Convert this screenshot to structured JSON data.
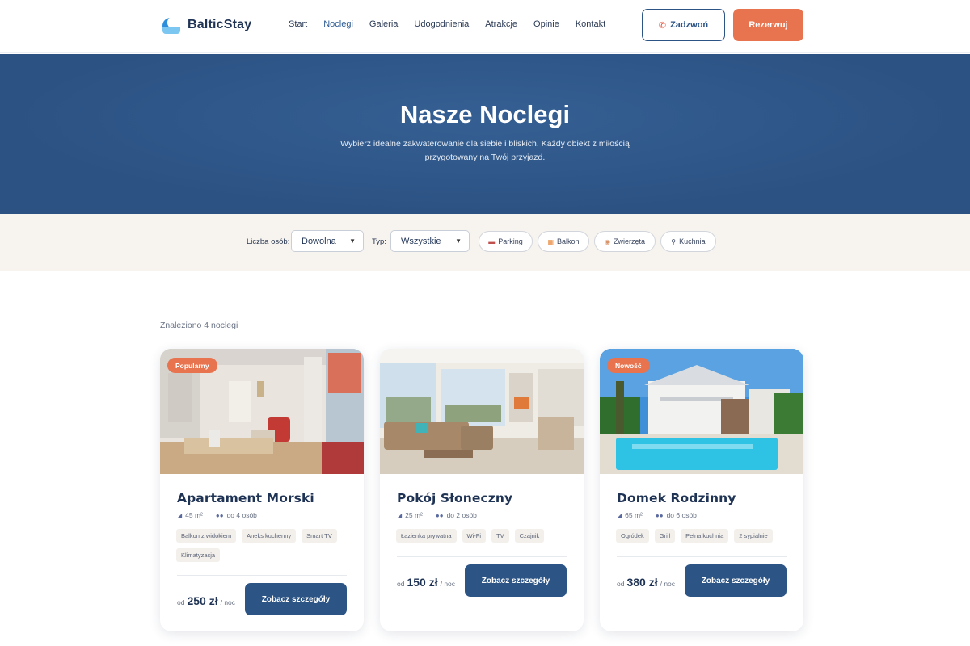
{
  "brand": {
    "name": "BalticStay"
  },
  "nav": {
    "items": [
      {
        "label": "Start",
        "active": false
      },
      {
        "label": "Noclegi",
        "active": true
      },
      {
        "label": "Galeria",
        "active": false
      },
      {
        "label": "Udogodnienia",
        "active": false
      },
      {
        "label": "Atrakcje",
        "active": false
      },
      {
        "label": "Opinie",
        "active": false
      },
      {
        "label": "Kontakt",
        "active": false
      }
    ],
    "call_label": "Zadzwoń",
    "book_label": "Rezerwuj"
  },
  "hero": {
    "title": "Nasze Noclegi",
    "subtitle": "Wybierz idealne zakwaterowanie dla siebie i bliskich. Każdy obiekt z miłością przygotowany na Twój przyjazd."
  },
  "filters": {
    "guests_label": "Liczba osób:",
    "guests_value": "Dowolna",
    "type_label": "Typ:",
    "type_value": "Wszystkie",
    "chips": [
      {
        "label": "Parking",
        "icon": "car-icon"
      },
      {
        "label": "Balkon",
        "icon": "balcony-icon"
      },
      {
        "label": "Zwierzęta",
        "icon": "pet-icon"
      },
      {
        "label": "Kuchnia",
        "icon": "kitchen-icon"
      }
    ]
  },
  "results": {
    "count_text": "Znaleziono 4 noclegi"
  },
  "cards": [
    {
      "badge": "Popularny",
      "title": "Apartament Morski",
      "area": "45 m²",
      "guests": "do 4 osób",
      "tags": [
        "Balkon z widokiem",
        "Aneks kuchenny",
        "Smart TV",
        "Klimatyzacja"
      ],
      "price_prefix": "od",
      "price": "250 zł",
      "price_suffix": "/ noc",
      "button": "Zobacz szczegóły"
    },
    {
      "badge": "",
      "title": "Pokój Słoneczny",
      "area": "25 m²",
      "guests": "do 2 osób",
      "tags": [
        "Łazienka prywatna",
        "Wi-Fi",
        "TV",
        "Czajnik"
      ],
      "price_prefix": "od",
      "price": "150 zł",
      "price_suffix": "/ noc",
      "button": "Zobacz szczegóły"
    },
    {
      "badge": "Nowość",
      "title": "Domek Rodzinny",
      "area": "65 m²",
      "guests": "do 6 osób",
      "tags": [
        "Ogródek",
        "Grill",
        "Pełna kuchnia",
        "2 sypialnie"
      ],
      "price_prefix": "od",
      "price": "380 zł",
      "price_suffix": "/ noc",
      "button": "Zobacz szczegóły"
    }
  ]
}
